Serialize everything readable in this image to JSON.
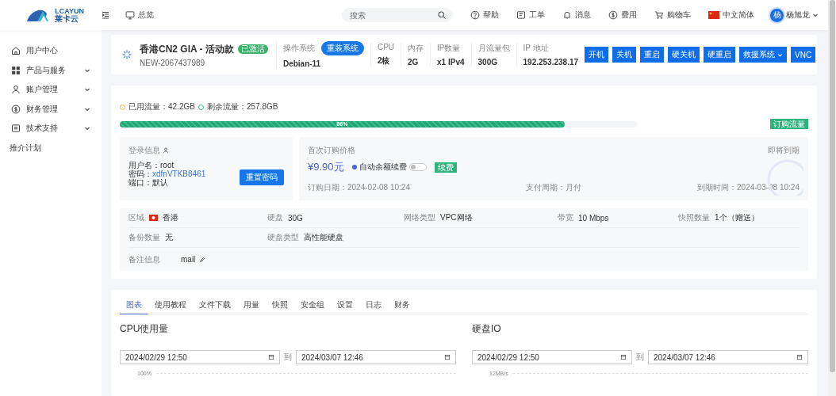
{
  "header": {
    "logo": {
      "text": "LCAYUN",
      "sub": "莱卡云"
    },
    "nav": "总览",
    "search": {
      "placeholder": "搜索"
    },
    "items": [
      {
        "kind": "help",
        "label": "帮助"
      },
      {
        "kind": "ticket",
        "label": "工单"
      },
      {
        "kind": "bell",
        "label": "消息"
      },
      {
        "kind": "coin",
        "label": "费用"
      },
      {
        "kind": "cart",
        "label": "购物车"
      },
      {
        "kind": "flag",
        "label": "中文简体"
      }
    ],
    "user": {
      "avatar": "杨",
      "name": "杨旭龙"
    }
  },
  "sidebar": {
    "items": [
      {
        "kind": "home",
        "label": "用户中心",
        "has_children": false
      },
      {
        "kind": "grid",
        "label": "产品与服务",
        "has_children": true
      },
      {
        "kind": "person",
        "label": "账户管理",
        "has_children": true
      },
      {
        "kind": "coin",
        "label": "财务管理",
        "has_children": true
      },
      {
        "kind": "doc",
        "label": "技术支持",
        "has_children": true
      },
      {
        "kind": "none",
        "label": "推介计划",
        "has_children": false
      }
    ]
  },
  "server": {
    "title": "香港CN2 GIA - 活动款",
    "status": "已激活",
    "id": "NEW-2067437989",
    "specs": [
      {
        "label": "操作系统",
        "value": "Debian-11",
        "button": "重装系统"
      },
      {
        "label": "CPU",
        "value": "2核"
      },
      {
        "label": "内存",
        "value": "2G"
      },
      {
        "label": "IP数量",
        "value": "x1 IPv4"
      },
      {
        "label": "月流量包",
        "value": "300G"
      },
      {
        "label": "IP 地址",
        "value": "192.253.238.17"
      }
    ],
    "actions": [
      {
        "label": "开机",
        "dropdown": false
      },
      {
        "label": "关机",
        "dropdown": false
      },
      {
        "label": "重启",
        "dropdown": false
      },
      {
        "label": "硬关机",
        "dropdown": false
      },
      {
        "label": "硬重启",
        "dropdown": false
      },
      {
        "label": "救援系统",
        "dropdown": true
      },
      {
        "label": "VNC",
        "dropdown": false
      }
    ]
  },
  "traffic": {
    "used": "已用流量：42.2GB",
    "remaining": "剩余流量：257.8GB",
    "level": 0.86,
    "percent": "86%",
    "button": "订购流量"
  },
  "login": {
    "title": "登录信息",
    "lines": [
      {
        "label": "用户名：",
        "value": "root",
        "link": false
      },
      {
        "label": "密码：",
        "value": "xdfnVTKB8461",
        "link": true
      },
      {
        "label": "端口：",
        "value": "默认",
        "link": false
      }
    ],
    "button": "重置密码"
  },
  "price": {
    "title": "首次订购价格",
    "amount": "¥9.90元",
    "auto_renew": {
      "label": "自动余额续费",
      "on": false
    },
    "renew": "续费",
    "expiry_note": "即将到期",
    "order_date": "订购日期：2024-02-08 10:24",
    "cycle": "支付周期：月付",
    "due": "到期时间：2024-03-08 10:24"
  },
  "details": {
    "rows": [
      [
        {
          "label": "区域",
          "value": "香港",
          "flag": true
        },
        {
          "label": "硬盘",
          "value": "30G"
        },
        {
          "label": "网络类型",
          "value": "VPC网络"
        },
        {
          "label": "带宽",
          "value": "10 Mbps"
        },
        {
          "label": "快照数量",
          "value": "1个（赠送）"
        }
      ],
      [
        {
          "label": "备份数量",
          "value": "无"
        },
        {
          "label": "硬盘类型",
          "value": "高性能硬盘"
        }
      ]
    ],
    "note": {
      "label": "备注信息",
      "value": "mail"
    }
  },
  "tabs": [
    {
      "label": "图表",
      "selected": true
    },
    {
      "label": "使用教程",
      "selected": false
    },
    {
      "label": "文件下载",
      "selected": false
    },
    {
      "label": "用量",
      "selected": false
    },
    {
      "label": "快照",
      "selected": false
    },
    {
      "label": "安全组",
      "selected": false
    },
    {
      "label": "设置",
      "selected": false
    },
    {
      "label": "日志",
      "selected": false
    },
    {
      "label": "财务",
      "selected": false
    }
  ],
  "panels": [
    {
      "title": "CPU使用量",
      "from": "2024/02/29 12:50",
      "sep": "到",
      "to": "2024/03/07 12:46",
      "axis": "100%"
    },
    {
      "title": "硬盘IO",
      "from": "2024/02/29 12:50",
      "sep": "到",
      "to": "2024/03/07 12:46",
      "axis": "12MB/s"
    }
  ]
}
